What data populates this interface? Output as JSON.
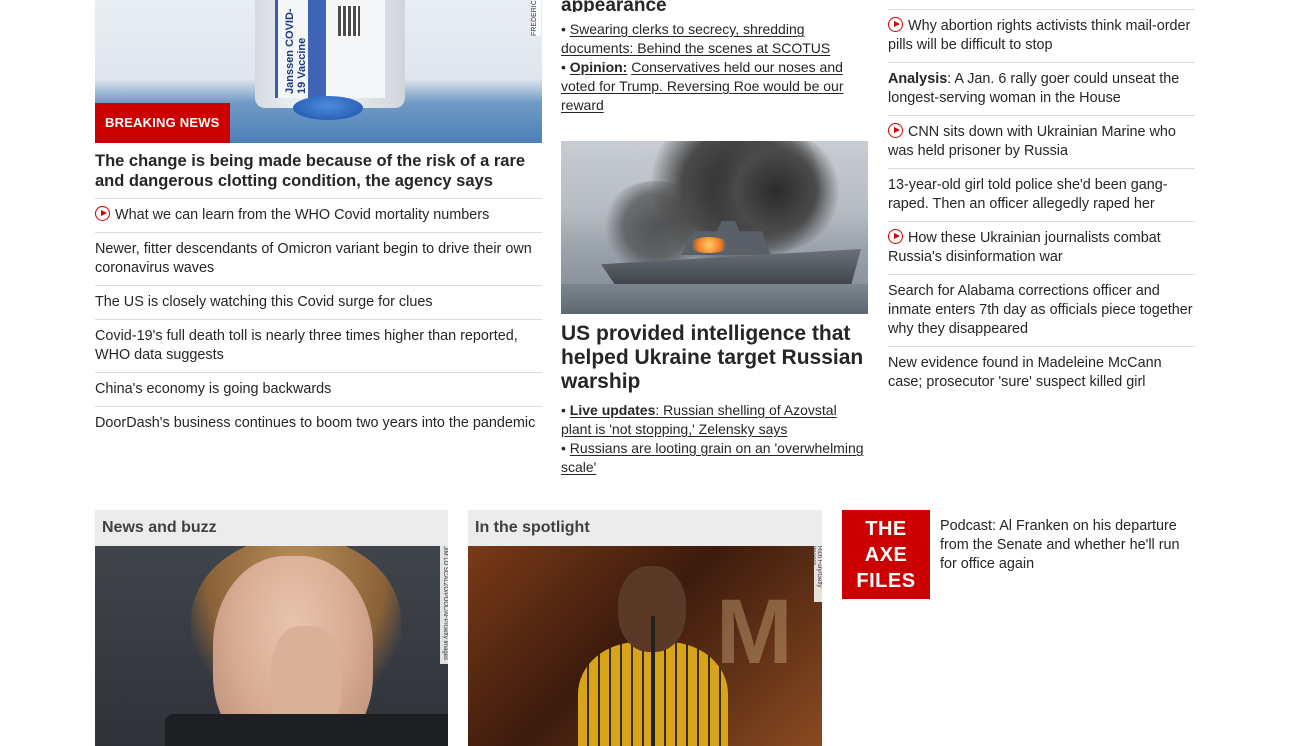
{
  "col1": {
    "badge": "BREAKING NEWS",
    "hero_headline": "The change is being made because of the risk of a rare and dangerous clotting condition, the agency says",
    "image_credit": "FREDERIC",
    "vial_text": "Janssen COVID-19 Vaccine",
    "items": [
      {
        "text": "What we can learn from the WHO Covid mortality numbers",
        "video": true
      },
      {
        "text": "Newer, fitter descendants of Omicron variant begin to drive their own coronavirus waves",
        "video": false
      },
      {
        "text": "The US is closely watching this Covid surge for clues",
        "video": false
      },
      {
        "text": "Covid-19's full death toll is nearly three times higher than reported, WHO data suggests",
        "video": false
      },
      {
        "text": "China's economy is going backwards",
        "video": false
      },
      {
        "text": "DoorDash's business continues to boom two years into the pandemic",
        "video": false
      }
    ]
  },
  "col2": {
    "top_headline_tail": "appearance",
    "top_bullets": [
      {
        "prefix": "",
        "text": "Swearing clerks to secrecy, shredding documents: Behind the scenes at SCOTUS"
      },
      {
        "prefix": "Opinion:",
        "text": "Conservatives held our noses and voted for Trump. Reversing Roe would be our reward"
      }
    ],
    "ship_headline": "US provided intelligence that helped Ukraine target Russian warship",
    "ship_bullets": [
      {
        "prefix": "Live updates",
        "text": ": Russian shelling of Azovstal plant is 'not stopping,' Zelensky says"
      },
      {
        "prefix": "",
        "text": "Russians are looting grain on an 'overwhelming scale'"
      }
    ]
  },
  "col3": {
    "items": [
      {
        "label": "",
        "text": "Why abortion rights activists think mail-order pills will be difficult to stop",
        "video": true
      },
      {
        "label": "Analysis",
        "text": ": A Jan. 6 rally goer could unseat the longest-serving woman in the House",
        "video": false
      },
      {
        "label": "",
        "text": "CNN sits down with Ukrainian Marine who was held prisoner by Russia",
        "video": true
      },
      {
        "label": "",
        "text": "13-year-old girl told police she'd been gang-raped. Then an officer allegedly raped her",
        "video": false
      },
      {
        "label": "",
        "text": "How these Ukrainian journalists combat Russia's disinformation war",
        "video": true
      },
      {
        "label": "",
        "text": "Search for Alabama corrections officer and inmate enters 7th day as officials piece together why they disappeared",
        "video": false
      },
      {
        "label": "",
        "text": "New evidence found in Madeleine McCann case; prosecutor 'sure' suspect killed girl",
        "video": false
      }
    ]
  },
  "zones": {
    "news_buzz": {
      "title": "News and buzz",
      "credit": "JIM LO SCALZO/POOL/AFP/Getty Images"
    },
    "spotlight": {
      "title": "In the spotlight",
      "credit": "Rich Fury/Getty Images"
    },
    "podcast": {
      "logo_lines": [
        "THE",
        "AXE",
        "FILES"
      ],
      "text": "Podcast: Al Franken on his departure from the Senate and whether he'll run for office again"
    }
  },
  "colors": {
    "accent": "#cc0000",
    "text": "#262626",
    "divider": "#dcdcdc",
    "zone_bg": "#ececec"
  }
}
